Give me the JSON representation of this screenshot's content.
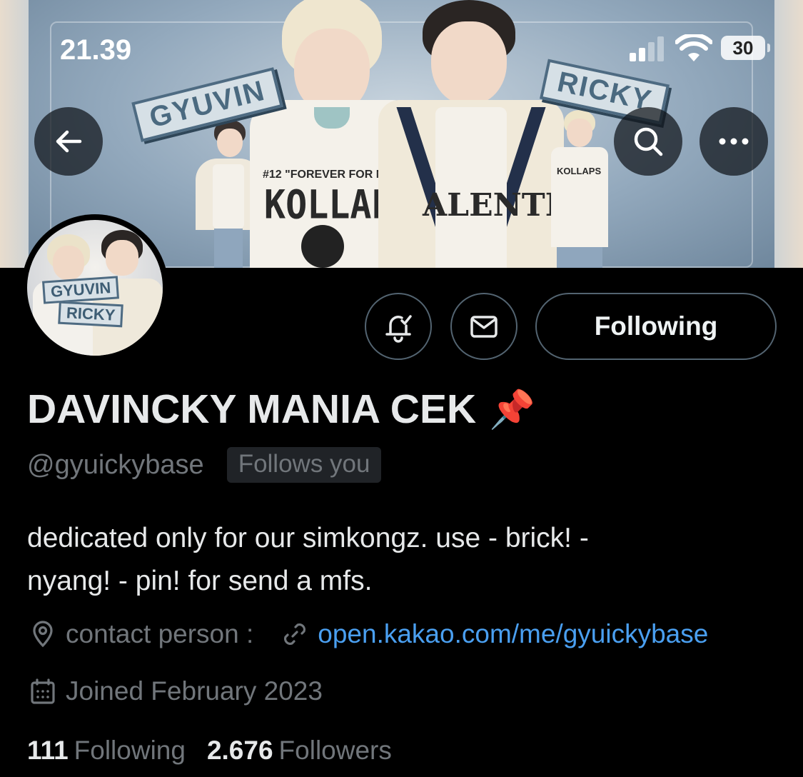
{
  "status_bar": {
    "time": "21.39",
    "battery": "30"
  },
  "banner": {
    "sticker_left": "GYUVIN",
    "sticker_right": "RICKY",
    "shirt_left": "#12 \"FOREVER FOR NO",
    "shirt_left_big": "KOLLAP",
    "shirt_right_big": "ALENTI",
    "small_shirt_text": "KOLLAPS"
  },
  "nav": {
    "back_icon": "arrow-left-icon",
    "search_icon": "search-icon",
    "more_icon": "more-horizontal-icon"
  },
  "avatar": {
    "tag_top": "GYUVIN",
    "tag_bottom": "RICKY"
  },
  "actions": {
    "notify_icon": "bell-check-icon",
    "message_icon": "envelope-icon",
    "following_label": "Following"
  },
  "profile": {
    "display_name": "DAVINCKY MANIA CEK",
    "name_emoji": "📌",
    "handle": "@gyuickybase",
    "follows_you": "Follows you",
    "bio_line1": "dedicated only for our simkongz. use - brick! -",
    "bio_line2": "nyang! - pin! for send a mfs.",
    "contact_label": "contact person :",
    "link": "open.kakao.com/me/gyuickybase",
    "joined": "Joined February 2023",
    "following_count": "111",
    "following_label": "Following",
    "followers_count": "2.676",
    "followers_label": "Followers"
  },
  "colors": {
    "background": "#000000",
    "text_primary": "#e7e9ea",
    "text_secondary": "#71767b",
    "link": "#4a9ff0",
    "border": "#536471"
  }
}
